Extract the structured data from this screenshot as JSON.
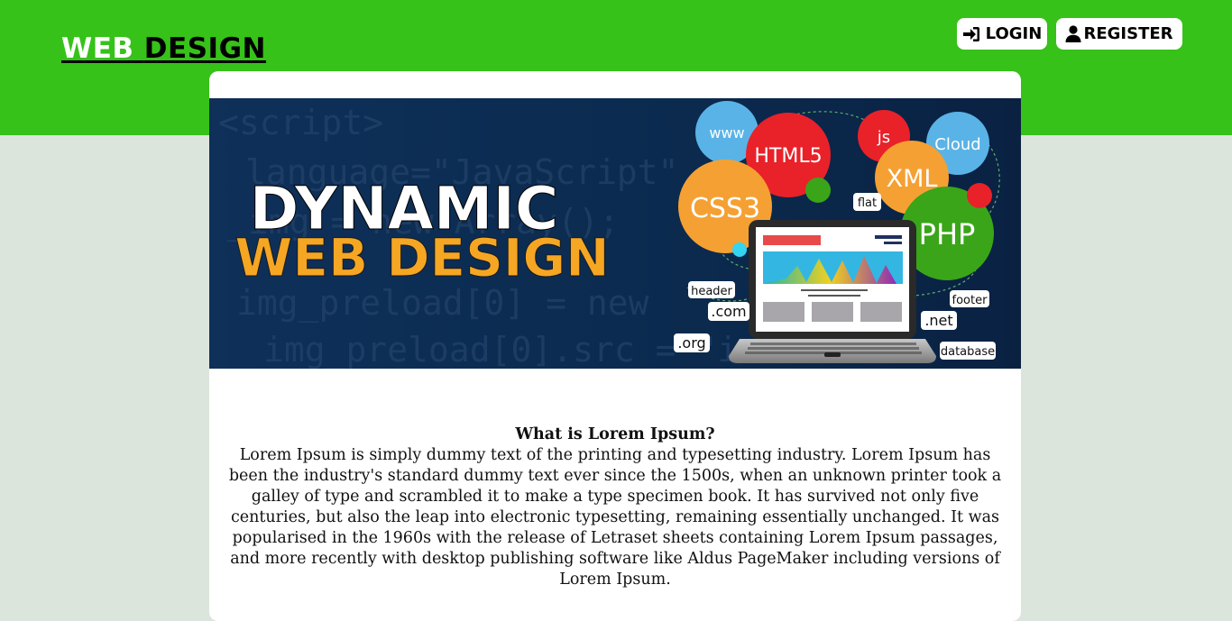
{
  "header": {
    "logo_word1": "WEB",
    "logo_word2": "DESIGN",
    "login_label": "LOGIN",
    "register_label": "REGISTER",
    "login_icon": "sign-in-icon",
    "register_icon": "user-icon"
  },
  "banner": {
    "title_line1": "DYNAMIC",
    "title_line2": "WEB DESIGN",
    "bubbles": [
      "www",
      "HTML5",
      "js",
      "Cloud",
      "CSS3",
      "XML",
      "PHP"
    ],
    "tags": [
      "flat",
      "header",
      ".com",
      ".org",
      "footer",
      ".net",
      "database"
    ]
  },
  "article": {
    "heading": "What is Lorem Ipsum?",
    "body": "Lorem Ipsum is simply dummy text of the printing and typesetting industry. Lorem Ipsum has been the industry's standard dummy text ever since the 1500s, when an unknown printer took a galley of type and scrambled it to make a type specimen book. It has survived not only five centuries, but also the leap into electronic typesetting, remaining essentially unchanged. It was popularised in the 1960s with the release of Letraset sheets containing Lorem Ipsum passages, and more recently with desktop publishing software like Aldus PageMaker including versions of Lorem Ipsum."
  },
  "colors": {
    "header_bg": "#36c219",
    "page_bg": "#dce5dc",
    "banner_bg": "#0b2a4e",
    "banner_accent": "#f5a623"
  }
}
